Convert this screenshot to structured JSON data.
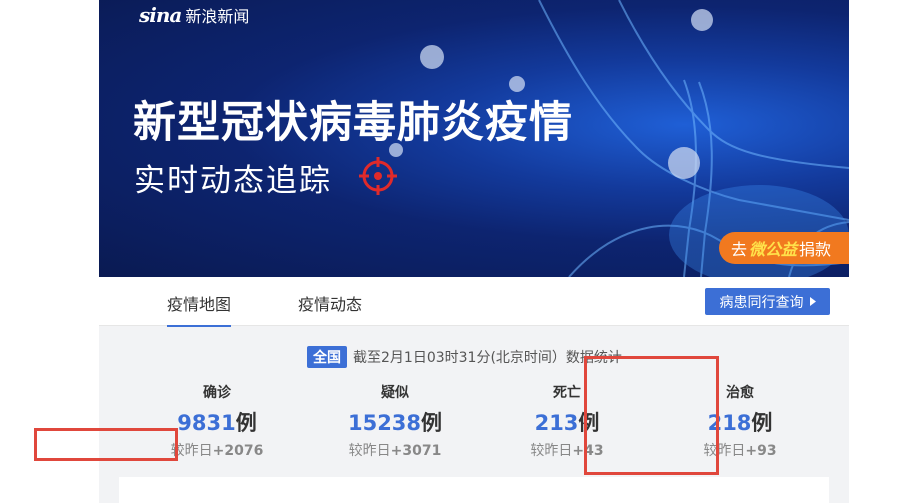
{
  "banner": {
    "logo_brand": "sina",
    "logo_text": "新浪新闻",
    "headline": "新型冠状病毒肺炎疫情",
    "subline": "实时动态追踪",
    "donate": {
      "prefix": "去",
      "brand": "微公益",
      "suffix": "捐款"
    }
  },
  "tabs": {
    "items": [
      {
        "label": "疫情地图",
        "active": true
      },
      {
        "label": "疫情动态",
        "active": false
      }
    ],
    "query_button": "病患同行查询"
  },
  "stats": {
    "scope": "全国",
    "updated": "截至2月1日03时31分(北京时间）数据统计",
    "items": [
      {
        "label": "确诊",
        "value": "9831",
        "unit": "例",
        "delta_label": "较昨日",
        "delta": "+2076"
      },
      {
        "label": "疑似",
        "value": "15238",
        "unit": "例",
        "delta_label": "较昨日",
        "delta": "+3071"
      },
      {
        "label": "死亡",
        "value": "213",
        "unit": "例",
        "delta_label": "较昨日",
        "delta": "+43"
      },
      {
        "label": "治愈",
        "value": "218",
        "unit": "例",
        "delta_label": "较昨日",
        "delta": "+93"
      }
    ]
  },
  "colors": {
    "accent": "#3c6fd6",
    "highlight": "#e0473c",
    "donate": "#f1791f",
    "banner": "#0d2470"
  }
}
